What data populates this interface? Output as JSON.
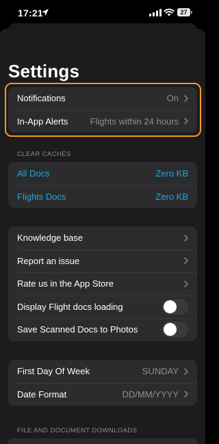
{
  "status": {
    "time": "17:21",
    "battery": "27"
  },
  "page": {
    "title": "Settings"
  },
  "alerts_group": [
    {
      "label": "Notifications",
      "value": "On"
    },
    {
      "label": "In-App Alerts",
      "value": "Flights within 24 hours"
    }
  ],
  "caches": {
    "header": "CLEAR CACHES",
    "items": [
      {
        "label": "All Docs",
        "value": "Zero KB"
      },
      {
        "label": "Flights Docs",
        "value": "Zero KB"
      }
    ]
  },
  "support_group": {
    "items": [
      {
        "label": "Knowledge base"
      },
      {
        "label": "Report an issue"
      },
      {
        "label": "Rate us in the App Store"
      }
    ],
    "toggles": [
      {
        "label": "Display Flight docs loading",
        "on": false
      },
      {
        "label": "Save Scanned Docs to Photos",
        "on": false
      }
    ]
  },
  "format_group": [
    {
      "label": "First Day Of Week",
      "value": "SUNDAY"
    },
    {
      "label": "Date Format",
      "value": "DD/MM/YYYY"
    }
  ],
  "downloads": {
    "header": "FILE AND DOCUMENT DOWNLOADS"
  },
  "colors": {
    "accent": "#1ea6e0",
    "highlight": "#f59a23",
    "background": "#1c1c1e",
    "card": "#2c2c2e"
  },
  "icons": [
    "location-arrow-icon",
    "cellular-signal-icon",
    "wifi-icon",
    "battery-icon",
    "chevron-right-icon"
  ]
}
